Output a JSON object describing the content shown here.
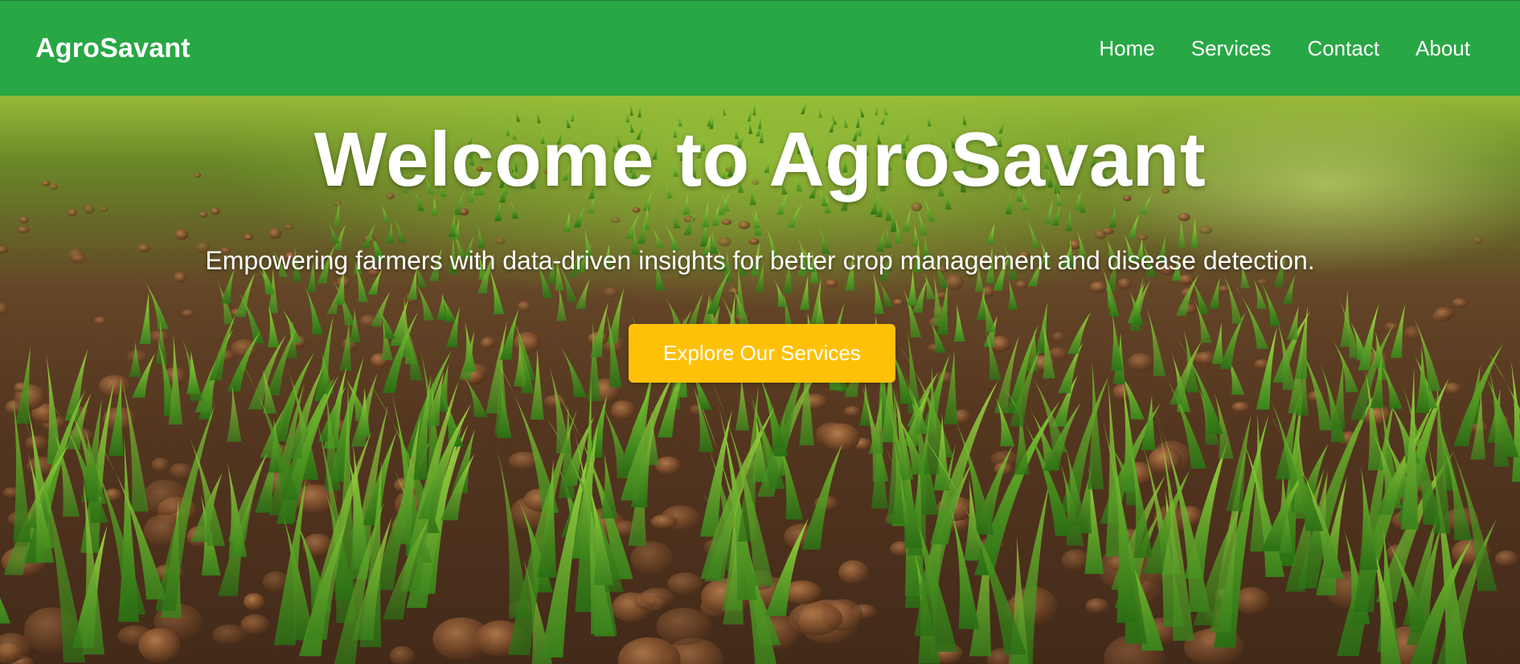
{
  "navbar": {
    "brand": "AgroSavant",
    "links": [
      "Home",
      "Services",
      "Contact",
      "About"
    ],
    "background_color": "#28a745"
  },
  "hero": {
    "title": "Welcome to AgroSavant",
    "subtitle": "Empowering farmers with data-driven insights for better crop management and disease detection.",
    "cta_label": "Explore Our Services",
    "cta_color": "#ffc107",
    "background_image": "field-of-young-green-crop-seedlings-in-brown-soil"
  }
}
